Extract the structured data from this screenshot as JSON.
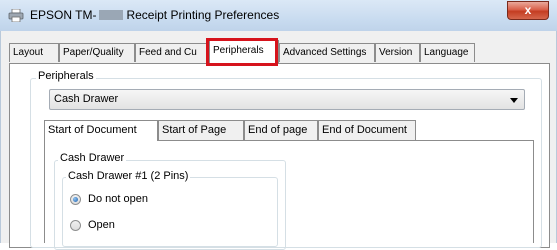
{
  "window": {
    "title_prefix": "EPSON TM-",
    "title_suffix": "Receipt Printing Preferences",
    "close_label": "x"
  },
  "top_tabs": [
    {
      "label": "Layout"
    },
    {
      "label": "Paper/Quality"
    },
    {
      "label": "Feed and Cu"
    },
    {
      "label": "Peripherals"
    },
    {
      "label": "Advanced Settings"
    },
    {
      "label": "Version"
    },
    {
      "label": "Language"
    }
  ],
  "active_top_tab": "Peripherals",
  "peripherals": {
    "group_label": "Peripherals",
    "device_select": {
      "value": "Cash Drawer"
    }
  },
  "inner_tabs": [
    {
      "label": "Start of Document"
    },
    {
      "label": "Start of Page"
    },
    {
      "label": "End of page"
    },
    {
      "label": "End of Document"
    }
  ],
  "cash_drawer": {
    "group_label": "Cash Drawer",
    "subgroup_label": "Cash Drawer #1 (2 Pins)",
    "options": [
      {
        "label": "Do not open",
        "checked": true
      },
      {
        "label": "Open",
        "checked": false
      }
    ]
  },
  "colors": {
    "highlight": "#d6131c"
  }
}
